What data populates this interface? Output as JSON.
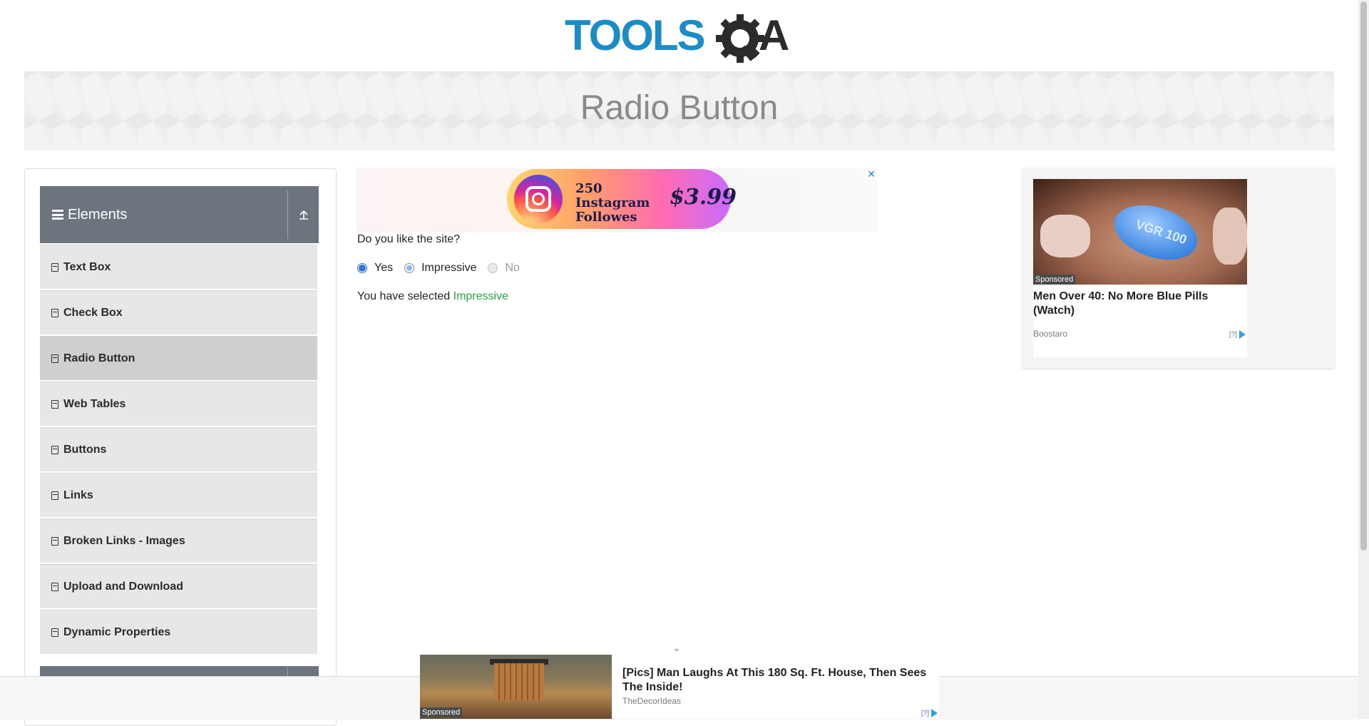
{
  "header": {
    "logo_text_main": "TOOLS",
    "logo_text_tail": "A",
    "logo_accent": "#1c8cc6"
  },
  "banner": {
    "title": "Radio Button"
  },
  "sidebar": {
    "group_title": "Elements",
    "items": [
      {
        "label": "Text Box"
      },
      {
        "label": "Check Box"
      },
      {
        "label": "Radio Button",
        "active": true
      },
      {
        "label": "Web Tables"
      },
      {
        "label": "Buttons"
      },
      {
        "label": "Links"
      },
      {
        "label": "Broken Links - Images"
      },
      {
        "label": "Upload and Download"
      },
      {
        "label": "Dynamic Properties"
      }
    ]
  },
  "main": {
    "question": "Do you like the site?",
    "options": [
      {
        "label": "Yes",
        "state": "checked"
      },
      {
        "label": "Impressive",
        "state": "unchecked"
      },
      {
        "label": "No",
        "state": "disabled"
      }
    ],
    "result_prefix": "You have selected ",
    "result_value": "Impressive",
    "result_color": "#28a745"
  },
  "ad_top": {
    "text": "250 Instagram Followes",
    "price": "$3.99",
    "close": "✕"
  },
  "ad_right": {
    "sponsored": "Sponsored",
    "pill_text": "VGR 100",
    "headline": "Men Over 40: No More Blue Pills (Watch)",
    "source": "Boostaro",
    "adchoice": "[?]"
  },
  "ad_bottom": {
    "sponsored": "Sponsored",
    "headline": "[Pics] Man Laughs At This 180 Sq. Ft. House, Then Sees The Inside!",
    "source": "TheDecorIdeas",
    "adchoice": "[?]"
  }
}
